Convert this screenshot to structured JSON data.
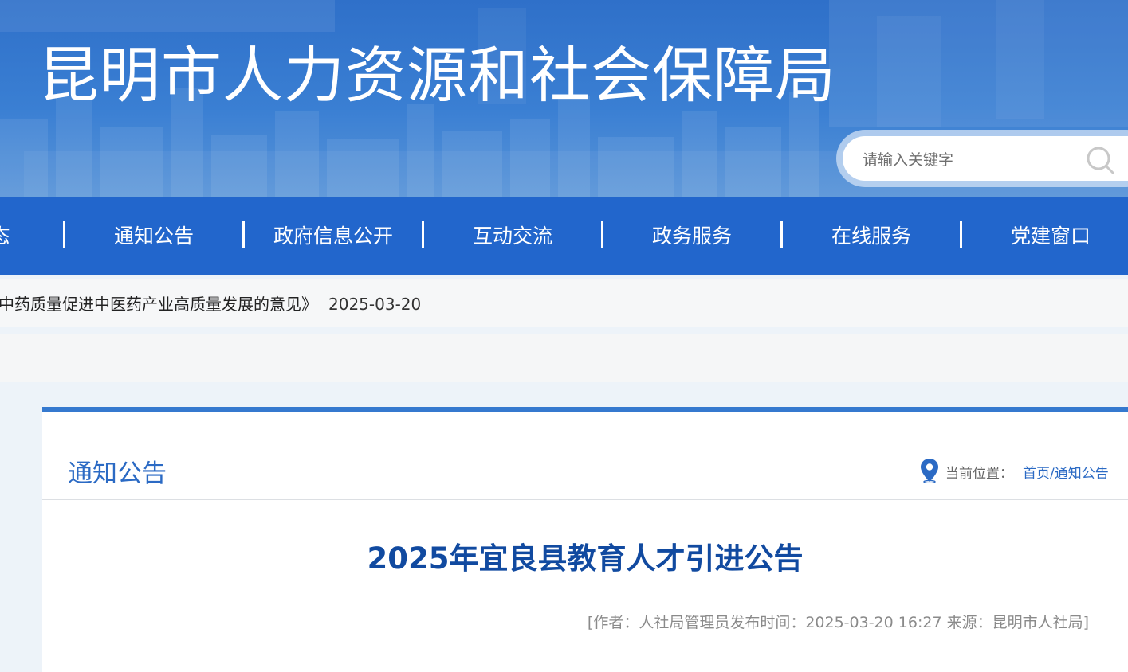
{
  "header": {
    "site_title": "昆明市人力资源和社会保障局",
    "search_placeholder": "请输入关键字"
  },
  "nav": {
    "items": [
      "态",
      "通知公告",
      "政府信息公开",
      "互动交流",
      "政务服务",
      "在线服务",
      "党建窗口"
    ]
  },
  "ticker": {
    "text": "中药质量促进中医药产业高质量发展的意见》",
    "date": "2025-03-20"
  },
  "section": {
    "title": "通知公告",
    "location_label": "当前位置：",
    "breadcrumb": "首页/通知公告"
  },
  "article": {
    "title": "2025年宜良县教育人才引进公告",
    "meta": "[作者：人社局管理员发布时间：2025-03-20 16:27 来源：昆明市人社局]"
  },
  "colors": {
    "nav_bg": "#2266cc",
    "accent": "#2b6ac4",
    "title_blue": "#114aa0"
  },
  "icons": {
    "search": "search-icon",
    "location": "location-pin-icon"
  }
}
